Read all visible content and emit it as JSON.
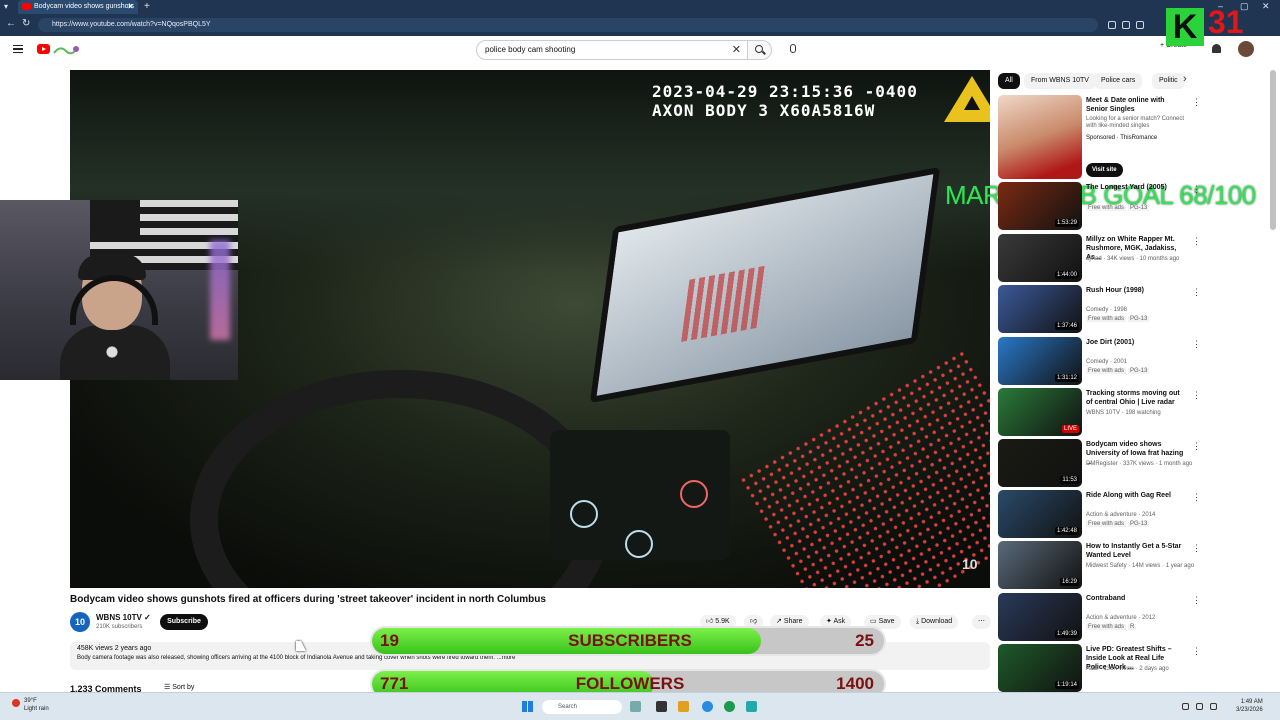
{
  "browser": {
    "tab_title": "Bodycam video shows gunshots",
    "url": "https://www.youtube.com/watch?v=NQqosPBQL5Y"
  },
  "youtube": {
    "search_value": "police body cam shooting",
    "create_label": "Create"
  },
  "video": {
    "overlay_line1": "2023-04-29 23:15:36 -0400",
    "overlay_line2": "AXON BODY 3 X60A5816W",
    "title": "Bodycam video shows gunshots fired at officers during 'street takeover' incident in north Columbus",
    "channel": "WBNS 10TV",
    "subscribers": "210K subscribers",
    "subscribe_label": "Subscribe",
    "likes": "5.9K",
    "share_label": "Share",
    "ask_label": "Ask",
    "save_label": "Save",
    "download_label": "Download",
    "views_date": "458K views  2 years ago",
    "description": "Body camera footage was also released, showing officers arriving at the 4100 block of Indianola Avenue and taking cover when shots were fired toward them.  ...more",
    "comments": "1,233 Comments",
    "sort_label": "Sort by"
  },
  "overlay": {
    "march_goal": "MARCH SUB GOAL 68/100",
    "k_badge": "K",
    "big_number": "31",
    "subs_bar": {
      "current": "19",
      "label": "SUBSCRIBERS",
      "target": "25",
      "progress": 0.76
    },
    "followers_bar": {
      "current": "771",
      "label": "FOLLOWERS",
      "target": "1400",
      "progress": 0.55
    }
  },
  "sidebar": {
    "chips": [
      "All",
      "From WBNS 10TV",
      "Police cars",
      "Politic"
    ],
    "ad": {
      "title": "Meet & Date online with Senior Singles",
      "text": "Looking for a senior match? Connect with like-minded singles",
      "sponsor": "Sponsored · ThisRomance",
      "cta": "Visit site"
    },
    "items": [
      {
        "title": "The Longest Yard (2005)",
        "meta": "",
        "tags": [
          "Free with ads",
          "PG-13"
        ],
        "dur": "1:53:29",
        "color": "#7a2a12"
      },
      {
        "title": "Millyz on White Rapper Mt. Rushmore, MGK, Jadakiss, As...",
        "meta": "djvlad · 34K views · 10 months ago",
        "tags": [],
        "dur": "1:44:00",
        "color": "#3a3a3a"
      },
      {
        "title": "Rush Hour (1998)",
        "meta": "Comedy · 1998",
        "tags": [
          "Free with ads",
          "PG-13"
        ],
        "dur": "1:37:46",
        "color": "#3b5a9a"
      },
      {
        "title": "Joe Dirt (2001)",
        "meta": "Comedy · 2001",
        "tags": [
          "Free with ads",
          "PG-13"
        ],
        "dur": "1:31:12",
        "color": "#2a78c8"
      },
      {
        "title": "Tracking storms moving out of central Ohio | Live radar",
        "meta": "WBNS 10TV · 198 watching",
        "tags": [],
        "dur": "LIVE",
        "color": "#2a7a3a"
      },
      {
        "title": "Bodycam video shows University of Iowa frat hazing ...",
        "meta": "DMRegister · 337K views · 1 month ago",
        "tags": [],
        "dur": "11:53",
        "color": "#1a1a14"
      },
      {
        "title": "Ride Along with Gag Reel",
        "meta": "Action & adventure · 2014",
        "tags": [
          "Free with ads",
          "PG-13"
        ],
        "dur": "1:42:48",
        "color": "#2a4a6a"
      },
      {
        "title": "How to Instantly Get a 5-Star Wanted Level",
        "meta": "Midwest Safety · 14M views · 1 year ago",
        "tags": [],
        "dur": "16:29",
        "color": "#5a6a7a"
      },
      {
        "title": "Contraband",
        "meta": "Action & adventure · 2012",
        "tags": [
          "Free with ads",
          "R"
        ],
        "dur": "1:49:39",
        "color": "#2a3a5a"
      },
      {
        "title": "Live PD: Greatest Shifts – Inside Look at Real Life Police Work ...",
        "meta": "A&E · 136K views · 2 days ago",
        "tags": [],
        "dur": "1:19:14",
        "color": "#1e5a2a"
      }
    ]
  },
  "taskbar": {
    "temp": "39°F",
    "weather": "Light rain",
    "search_placeholder": "Search",
    "time": "1:49 AM",
    "date": "3/23/2026"
  }
}
